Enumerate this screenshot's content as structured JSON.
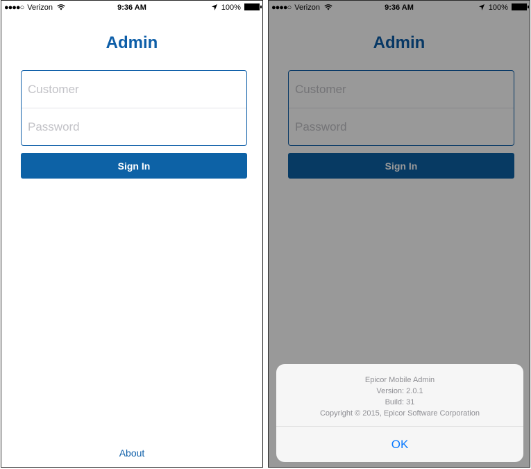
{
  "status_bar": {
    "signal": "●●●●○",
    "carrier": "Verizon",
    "time": "9:36 AM",
    "battery": "100%"
  },
  "login": {
    "title": "Admin",
    "customer_placeholder": "Customer",
    "password_placeholder": "Password",
    "signin_label": "Sign In",
    "about_label": "About"
  },
  "alert": {
    "app_name": "Epicor Mobile Admin",
    "version": "Version: 2.0.1",
    "build": "Build: 31",
    "copyright": "Copyright © 2015, Epicor Software Corporation",
    "ok_label": "OK"
  },
  "colors": {
    "accent": "#0d5ea8",
    "button": "#0d62a6",
    "alert_button": "#0a7aff"
  }
}
